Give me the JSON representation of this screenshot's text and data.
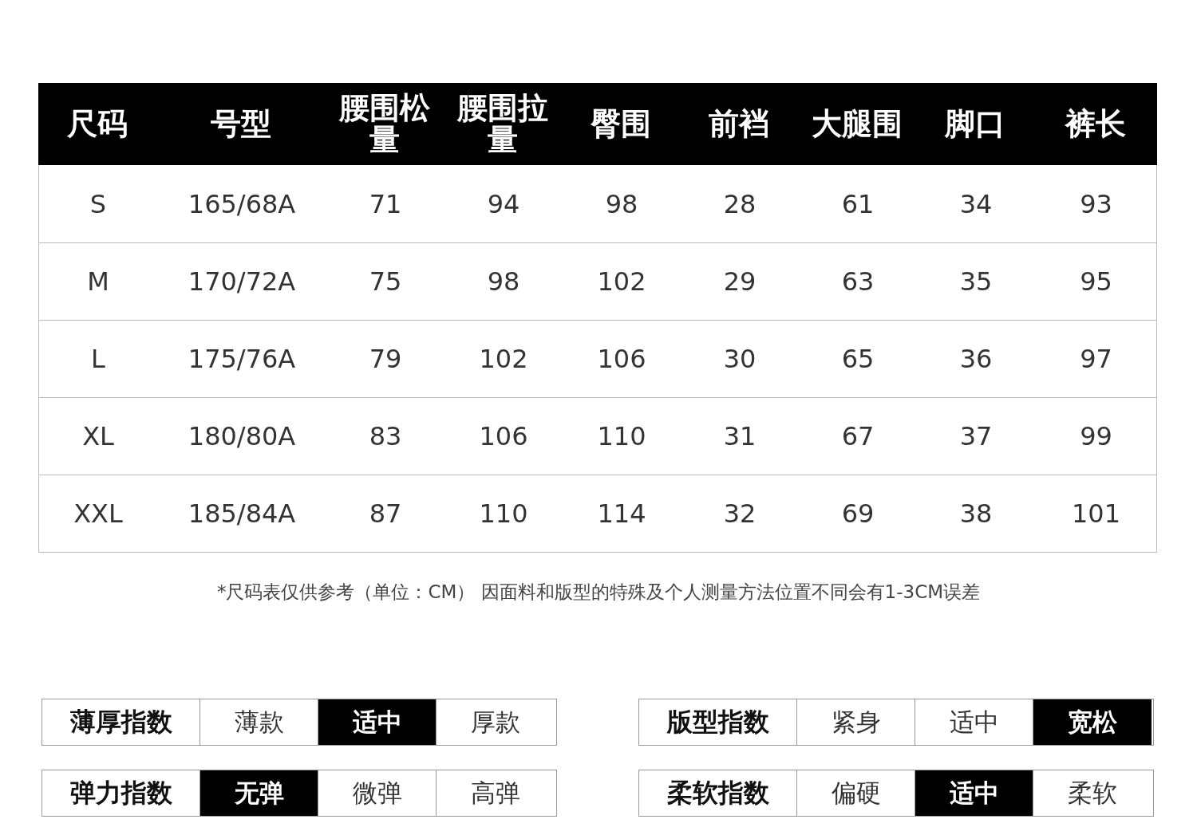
{
  "table": {
    "columns": [
      "尺码",
      "号型",
      "腰围松量",
      "腰围拉量",
      "臀围",
      "前裆",
      "大腿围",
      "脚口",
      "裤长"
    ],
    "rows": [
      [
        "S",
        "165/68A",
        "71",
        "94",
        "98",
        "28",
        "61",
        "34",
        "93"
      ],
      [
        "M",
        "170/72A",
        "75",
        "98",
        "102",
        "29",
        "63",
        "35",
        "95"
      ],
      [
        "L",
        "175/76A",
        "79",
        "102",
        "106",
        "30",
        "65",
        "36",
        "97"
      ],
      [
        "XL",
        "180/80A",
        "83",
        "106",
        "110",
        "31",
        "67",
        "37",
        "99"
      ],
      [
        "XXL",
        "185/84A",
        "87",
        "110",
        "114",
        "32",
        "69",
        "38",
        "101"
      ]
    ]
  },
  "note": "*尺码表仅供参考（单位：CM） 因面料和版型的特殊及个人测量方法位置不同会有1-3CM误差",
  "indices": [
    {
      "label": "薄厚指数",
      "options": [
        {
          "label": "薄款",
          "selected": false
        },
        {
          "label": "适中",
          "selected": true
        },
        {
          "label": "厚款",
          "selected": false
        }
      ]
    },
    {
      "label": "版型指数",
      "options": [
        {
          "label": "紧身",
          "selected": false
        },
        {
          "label": "适中",
          "selected": false
        },
        {
          "label": "宽松",
          "selected": true
        }
      ]
    },
    {
      "label": "弹力指数",
      "options": [
        {
          "label": "无弹",
          "selected": true
        },
        {
          "label": "微弹",
          "selected": false
        },
        {
          "label": "高弹",
          "selected": false
        }
      ]
    },
    {
      "label": "柔软指数",
      "options": [
        {
          "label": "偏硬",
          "selected": false
        },
        {
          "label": "适中",
          "selected": true
        },
        {
          "label": "柔软",
          "selected": false
        }
      ]
    }
  ]
}
